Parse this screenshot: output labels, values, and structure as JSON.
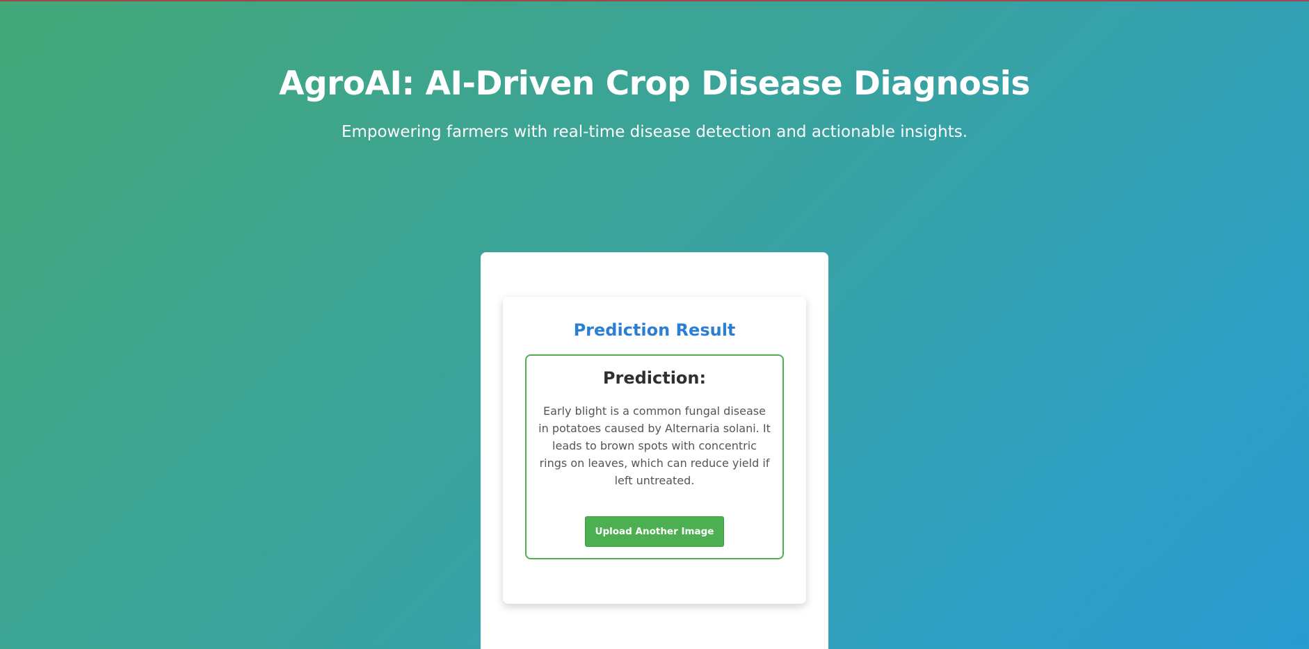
{
  "header": {
    "title": "AgroAI: AI-Driven Crop Disease Diagnosis",
    "subtitle": "Empowering farmers with real-time disease detection and actionable insights."
  },
  "result": {
    "heading": "Prediction Result",
    "prediction_label": "Prediction:",
    "description": "Early blight is a common fungal disease in potatoes caused by Alternaria solani. It leads to brown spots with concentric rings on leaves, which can reduce yield if left untreated.",
    "upload_button_label": "Upload Another Image"
  },
  "colors": {
    "heading_blue": "#2a7fd4",
    "accent_green": "#4caf50",
    "gradient_start": "#43a878",
    "gradient_end": "#2a9bd1"
  }
}
